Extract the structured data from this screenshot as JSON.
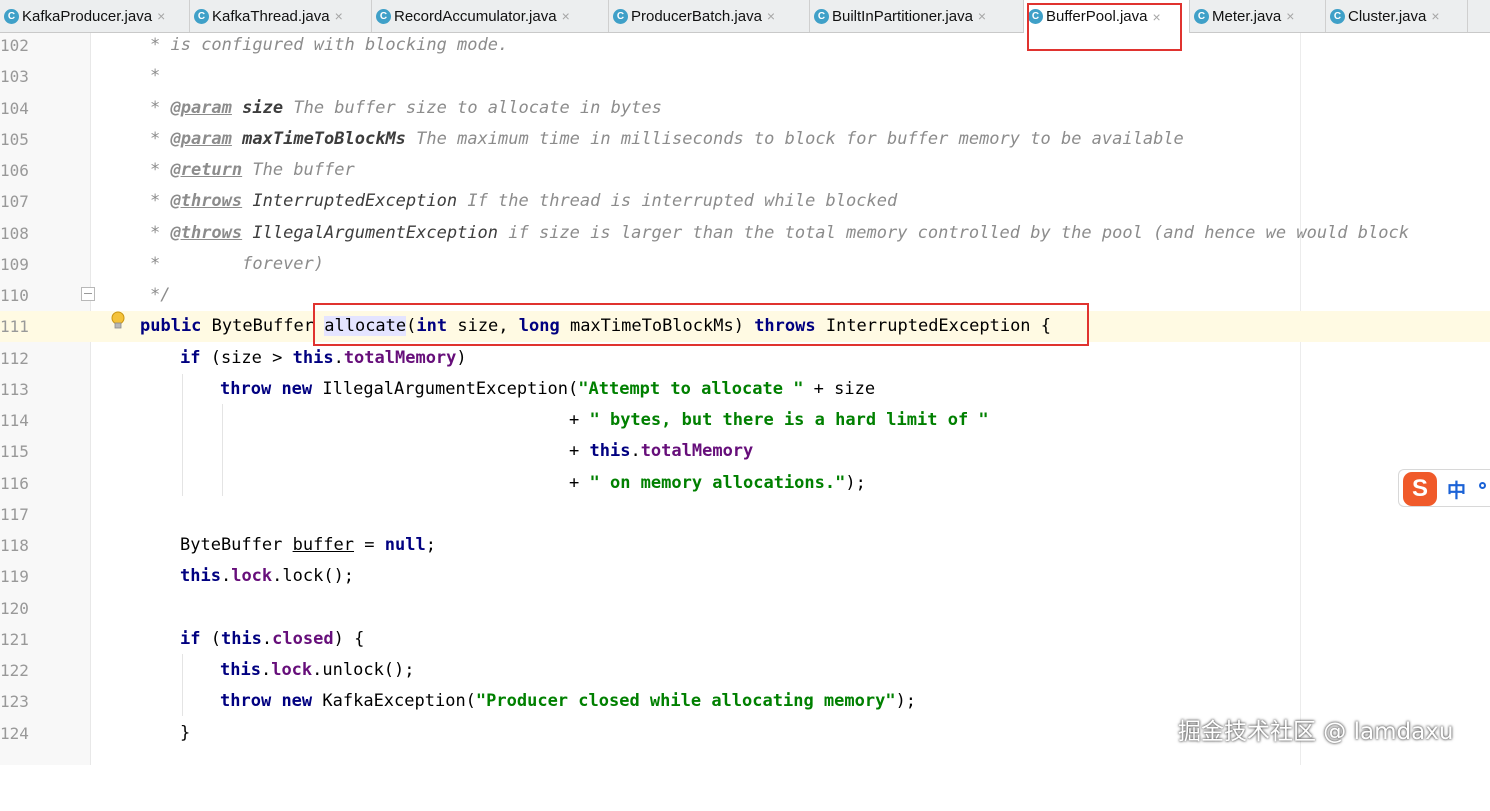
{
  "tabs": [
    {
      "label": "KafkaProducer.java",
      "active": false,
      "icon": "java-class-icon"
    },
    {
      "label": "KafkaThread.java",
      "active": false,
      "icon": "java-class-icon"
    },
    {
      "label": "RecordAccumulator.java",
      "active": false,
      "icon": "java-class-icon"
    },
    {
      "label": "ProducerBatch.java",
      "active": false,
      "icon": "java-class-icon"
    },
    {
      "label": "BuiltInPartitioner.java",
      "active": false,
      "icon": "java-class-icon"
    },
    {
      "label": "BufferPool.java",
      "active": true,
      "icon": "java-class-icon"
    },
    {
      "label": "Meter.java",
      "active": false,
      "icon": "java-class-icon"
    },
    {
      "label": "Cluster.java",
      "active": false,
      "icon": "java-class-icon"
    }
  ],
  "tab_icon_glyph": "C",
  "close_glyph": "×",
  "annotation_color": "#e0332f",
  "editor": {
    "line_numbers": [
      "102",
      "103",
      "104",
      "105",
      "106",
      "107",
      "108",
      "109",
      "110",
      "111",
      "112",
      "113",
      "114",
      "115",
      "116",
      "117",
      "118",
      "119",
      "120",
      "121",
      "122",
      "123",
      "124"
    ],
    "l102": {
      "star": "* ",
      "text": "is configured with blocking mode."
    },
    "l103": {
      "star": "*"
    },
    "l104": {
      "star": "* ",
      "tag": "@param",
      "param": "size",
      "desc": " The buffer size to allocate in bytes"
    },
    "l105": {
      "star": "* ",
      "tag": "@param",
      "param": "maxTimeToBlockMs",
      "desc": " The maximum time in milliseconds to block for buffer memory to be available"
    },
    "l106": {
      "star": "* ",
      "tag": "@return",
      "desc": " The buffer"
    },
    "l107": {
      "star": "* ",
      "tag": "@throws",
      "type": "InterruptedException",
      "desc": " If the thread is interrupted while blocked"
    },
    "l108": {
      "star": "* ",
      "tag": "@throws",
      "type": "IllegalArgumentException",
      "desc": " if size is larger than the total memory controlled by the pool (and hence we would block"
    },
    "l109": {
      "star": "*",
      "desc": "        forever)"
    },
    "l110": {
      "text": "*/"
    },
    "l111": {
      "kw_public": "public",
      "ret_type": " ByteBuffer ",
      "method": "allocate",
      "p_open": "(",
      "kw_int": "int",
      "p_size": " size, ",
      "kw_long": "long",
      "p_max": " maxTimeToBlockMs) ",
      "kw_throws": "throws",
      "exc": " InterruptedException {"
    },
    "l112": {
      "kw_if": "if",
      "a": " (size > ",
      "kw_this": "this",
      "dot": ".",
      "field": "totalMemory",
      "b": ")"
    },
    "l113": {
      "kw_throw": "throw",
      "sp": " ",
      "kw_new": "new",
      "cls": " IllegalArgumentException(",
      "str": "\"Attempt to allocate \"",
      "rest": " + size"
    },
    "l114": {
      "plus": "+ ",
      "str": "\" bytes, but there is a hard limit of \""
    },
    "l115": {
      "plus": "+ ",
      "kw_this": "this",
      "dot": ".",
      "field": "totalMemory"
    },
    "l116": {
      "plus": "+ ",
      "str": "\" on memory allocations.\"",
      "rest": ");"
    },
    "l118": {
      "type": "ByteBuffer ",
      "var": "buffer",
      "eq": " = ",
      "kw_null": "null",
      "semi": ";"
    },
    "l119": {
      "kw_this": "this",
      "dot": ".",
      "field": "lock",
      "rest": ".lock();"
    },
    "l121": {
      "kw_if": "if",
      "a": " (",
      "kw_this": "this",
      "dot": ".",
      "field": "closed",
      "b": ") {"
    },
    "l122": {
      "kw_this": "this",
      "dot": ".",
      "field": "lock",
      "rest": ".unlock();"
    },
    "l123": {
      "kw_throw": "throw",
      "sp": " ",
      "kw_new": "new",
      "cls": " KafkaException(",
      "str": "\"Producer closed while allocating memory\"",
      "rest": ");"
    },
    "l124": {
      "text": "}"
    }
  },
  "ime": {
    "logo": "S",
    "lang": "中"
  },
  "watermark": "掘金技术社区 @ lamdaxu"
}
